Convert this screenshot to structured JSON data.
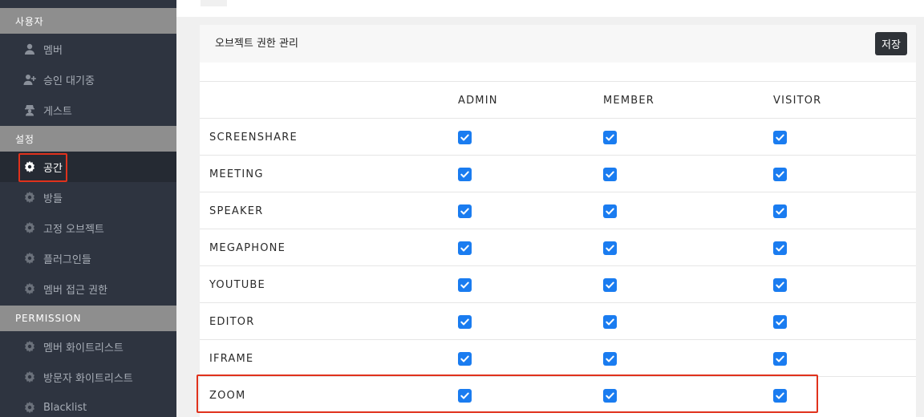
{
  "sidebar": {
    "sections": [
      {
        "title": "사용자",
        "items": [
          {
            "label": "멤버",
            "icon": "user-icon"
          },
          {
            "label": "승인 대기중",
            "icon": "user-plus-icon"
          },
          {
            "label": "게스트",
            "icon": "guest-icon"
          }
        ]
      },
      {
        "title": "설정",
        "items": [
          {
            "label": "공간",
            "icon": "gear-icon",
            "active": true
          },
          {
            "label": "방들",
            "icon": "gear-icon"
          },
          {
            "label": "고정 오브젝트",
            "icon": "gear-icon"
          },
          {
            "label": "플러그인들",
            "icon": "gear-icon"
          },
          {
            "label": "멤버 접근 권한",
            "icon": "gear-icon"
          }
        ]
      },
      {
        "title": "PERMISSION",
        "items": [
          {
            "label": "멤버 화이트리스트",
            "icon": "gear-icon"
          },
          {
            "label": "방문자 화이트리스트",
            "icon": "gear-icon"
          },
          {
            "label": "Blacklist",
            "icon": "gear-icon"
          }
        ]
      }
    ]
  },
  "panel": {
    "title": "오브젝트 권한 관리",
    "save_label": "저장",
    "columns": [
      "ADMIN",
      "MEMBER",
      "VISITOR"
    ],
    "rows": [
      {
        "label": "SCREENSHARE",
        "admin": true,
        "member": true,
        "visitor": true
      },
      {
        "label": "MEETING",
        "admin": true,
        "member": true,
        "visitor": true
      },
      {
        "label": "SPEAKER",
        "admin": true,
        "member": true,
        "visitor": true
      },
      {
        "label": "MEGAPHONE",
        "admin": true,
        "member": true,
        "visitor": true
      },
      {
        "label": "YOUTUBE",
        "admin": true,
        "member": true,
        "visitor": true
      },
      {
        "label": "EDITOR",
        "admin": true,
        "member": true,
        "visitor": true
      },
      {
        "label": "IFRAME",
        "admin": true,
        "member": true,
        "visitor": true
      },
      {
        "label": "ZOOM",
        "admin": true,
        "member": true,
        "visitor": true
      }
    ]
  },
  "colors": {
    "sidebar_bg": "#2e3440",
    "section_header_bg": "#8e8e8e",
    "checkbox_blue": "#1a7cf0",
    "highlight_red": "#e0321c",
    "save_button_bg": "#2f3338"
  }
}
